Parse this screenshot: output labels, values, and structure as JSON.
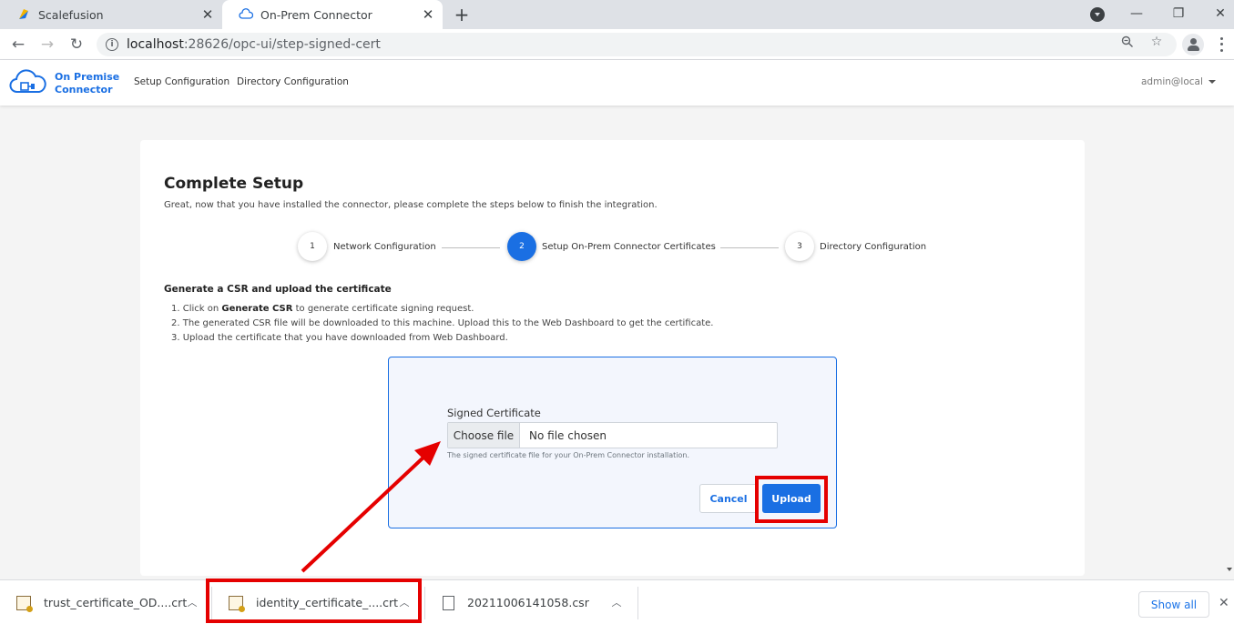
{
  "browser": {
    "tabs": [
      {
        "title": "Scalefusion",
        "icon": "scalefusion-icon",
        "active": false
      },
      {
        "title": "On-Prem Connector",
        "icon": "cloud-icon",
        "active": true
      }
    ],
    "url_host": "localhost",
    "url_path": ":28626/opc-ui/step-signed-cert"
  },
  "app": {
    "logo_line1": "On Premise",
    "logo_line2": "Connector",
    "nav": [
      "Setup Configuration",
      "Directory Configuration"
    ],
    "user": "admin@local",
    "brand_color": "#1a6fe3"
  },
  "page": {
    "title": "Complete Setup",
    "subtitle": "Great, now that you have installed the connector, please complete the steps below to finish the integration.",
    "steps": [
      {
        "number": "1",
        "label": "Network Configuration",
        "active": false
      },
      {
        "number": "2",
        "label": "Setup On-Prem Connector Certificates",
        "active": true
      },
      {
        "number": "3",
        "label": "Directory Configuration",
        "active": false
      }
    ],
    "section_title": "Generate a CSR and upload the certificate",
    "instructions": {
      "line1_prefix": "1. Click on ",
      "line1_bold": "Generate CSR",
      "line1_suffix": " to generate certificate signing request.",
      "line2": "2. The generated CSR file will be downloaded to this machine. Upload this to the Web Dashboard to get the certificate.",
      "line3": "3. Upload the certificate that you have downloaded from Web Dashboard."
    },
    "upload": {
      "label": "Signed Certificate",
      "choose_button": "Choose file",
      "status": "No file chosen",
      "help": "The signed certificate file for your On-Prem Connector installation.",
      "cancel": "Cancel",
      "submit": "Upload"
    }
  },
  "downloads": {
    "items": [
      {
        "name": "trust_certificate_OD....crt",
        "icon": "certificate-file-icon"
      },
      {
        "name": "identity_certificate_....crt",
        "icon": "certificate-file-icon"
      },
      {
        "name": "20211006141058.csr",
        "icon": "file-icon"
      }
    ],
    "show_all": "Show all"
  },
  "annotations": {
    "highlight_color": "#e50000"
  }
}
